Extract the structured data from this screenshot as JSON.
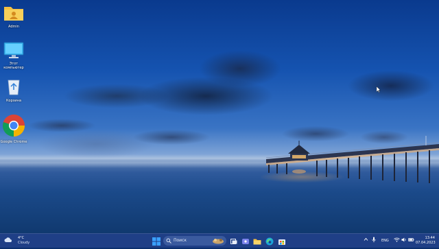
{
  "desktop": {
    "icons": [
      {
        "name": "user-folder",
        "label": "Admin"
      },
      {
        "name": "this-pc",
        "label": "Этот компьютер"
      },
      {
        "name": "recycle-bin",
        "label": "Корзина"
      },
      {
        "name": "google-chrome",
        "label": "Google Chrome"
      }
    ]
  },
  "taskbar": {
    "weather": {
      "temp": "4°C",
      "condition": "Cloudy"
    },
    "search_placeholder": "Поиск",
    "tray": {
      "language": "ENG"
    },
    "clock": {
      "time": "13:44",
      "date": "07.04.2023"
    }
  },
  "colors": {
    "taskbar": "#1f3f86",
    "start_accent": "#3aa0ff",
    "folder": "#f4c042"
  }
}
